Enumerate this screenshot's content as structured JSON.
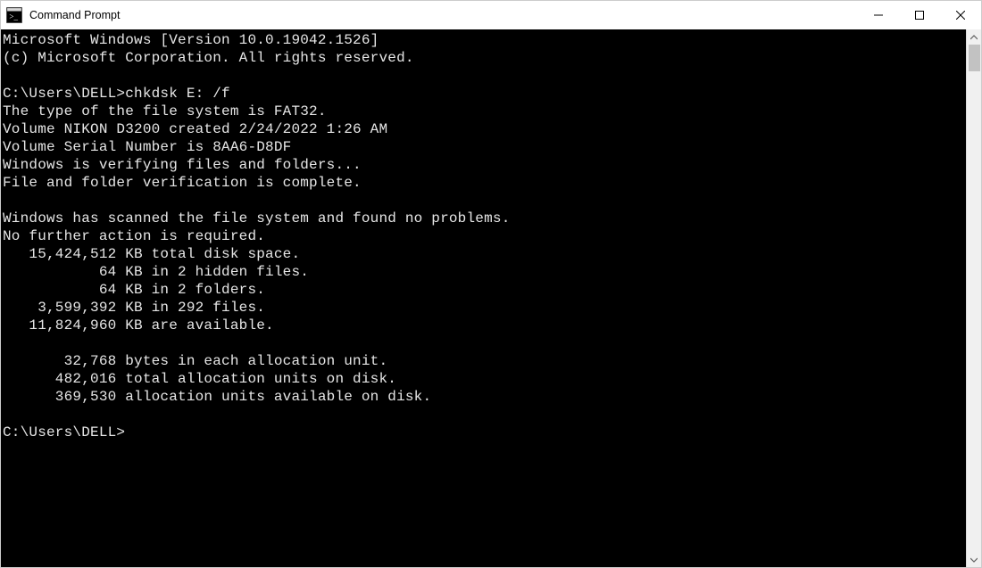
{
  "titlebar": {
    "title": "Command Prompt"
  },
  "console": {
    "lines": [
      "Microsoft Windows [Version 10.0.19042.1526]",
      "(c) Microsoft Corporation. All rights reserved.",
      "",
      "C:\\Users\\DELL>chkdsk E: /f",
      "The type of the file system is FAT32.",
      "Volume NIKON D3200 created 2/24/2022 1:26 AM",
      "Volume Serial Number is 8AA6-D8DF",
      "Windows is verifying files and folders...",
      "File and folder verification is complete.",
      "",
      "Windows has scanned the file system and found no problems.",
      "No further action is required.",
      "   15,424,512 KB total disk space.",
      "           64 KB in 2 hidden files.",
      "           64 KB in 2 folders.",
      "    3,599,392 KB in 292 files.",
      "   11,824,960 KB are available.",
      "",
      "       32,768 bytes in each allocation unit.",
      "      482,016 total allocation units on disk.",
      "      369,530 allocation units available on disk.",
      "",
      "C:\\Users\\DELL>"
    ]
  }
}
